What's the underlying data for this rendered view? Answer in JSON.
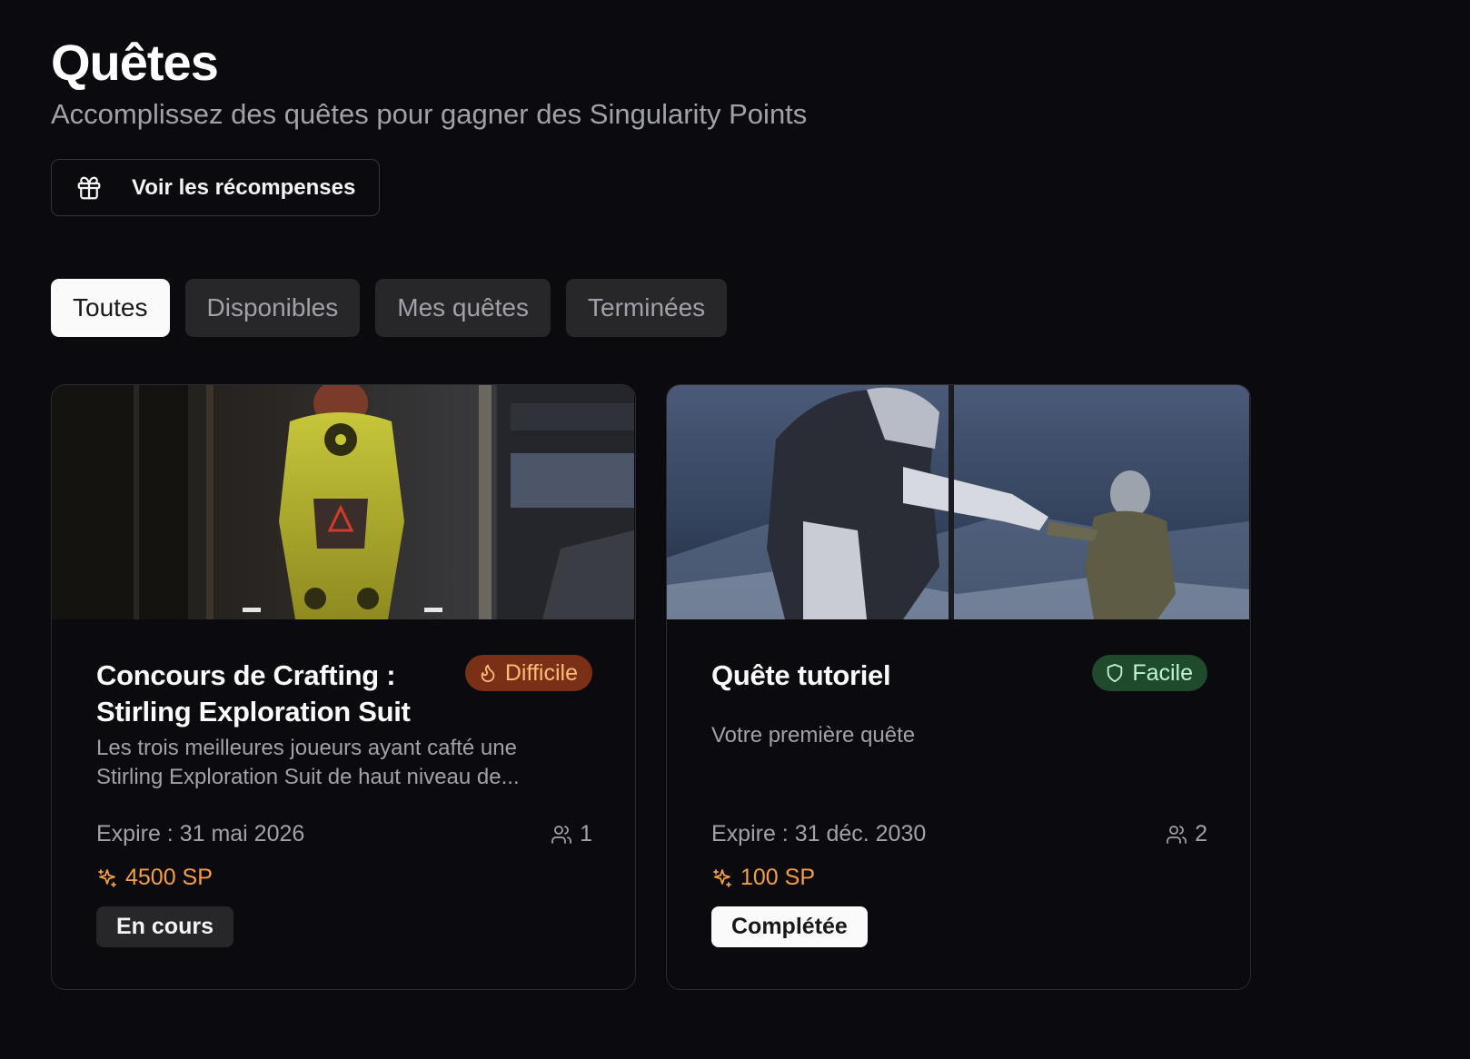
{
  "header": {
    "title": "Quêtes",
    "subtitle": "Accomplissez des quêtes pour gagner des Singularity Points"
  },
  "rewards_button": {
    "label": "Voir les récompenses",
    "icon": "gift-icon"
  },
  "tabs": [
    {
      "label": "Toutes",
      "active": true
    },
    {
      "label": "Disponibles",
      "active": false
    },
    {
      "label": "Mes quêtes",
      "active": false
    },
    {
      "label": "Terminées",
      "active": false
    }
  ],
  "quests": [
    {
      "name": "Concours de Crafting : Stirling Exploration Suit",
      "difficulty": "Difficile",
      "difficulty_icon": "flame-icon",
      "description": "Les trois meilleures joueurs ayant cafté une Stirling Exploration Suit de haut niveau de...",
      "expire": "Expire : 31 mai 2026",
      "participants": "1",
      "points": "4500 SP",
      "status": "En cours"
    },
    {
      "name": "Quête tutoriel",
      "difficulty": "Facile",
      "difficulty_icon": "shield-icon",
      "description": "Votre première quête",
      "expire": "Expire : 31 déc. 2030",
      "participants": "2",
      "points": "100 SP",
      "status": "Complétée"
    }
  ],
  "colors": {
    "background": "#0b0b0f",
    "hard_badge": "#7a2f17",
    "easy_badge": "#1f4a2b",
    "points": "#f59e42"
  }
}
